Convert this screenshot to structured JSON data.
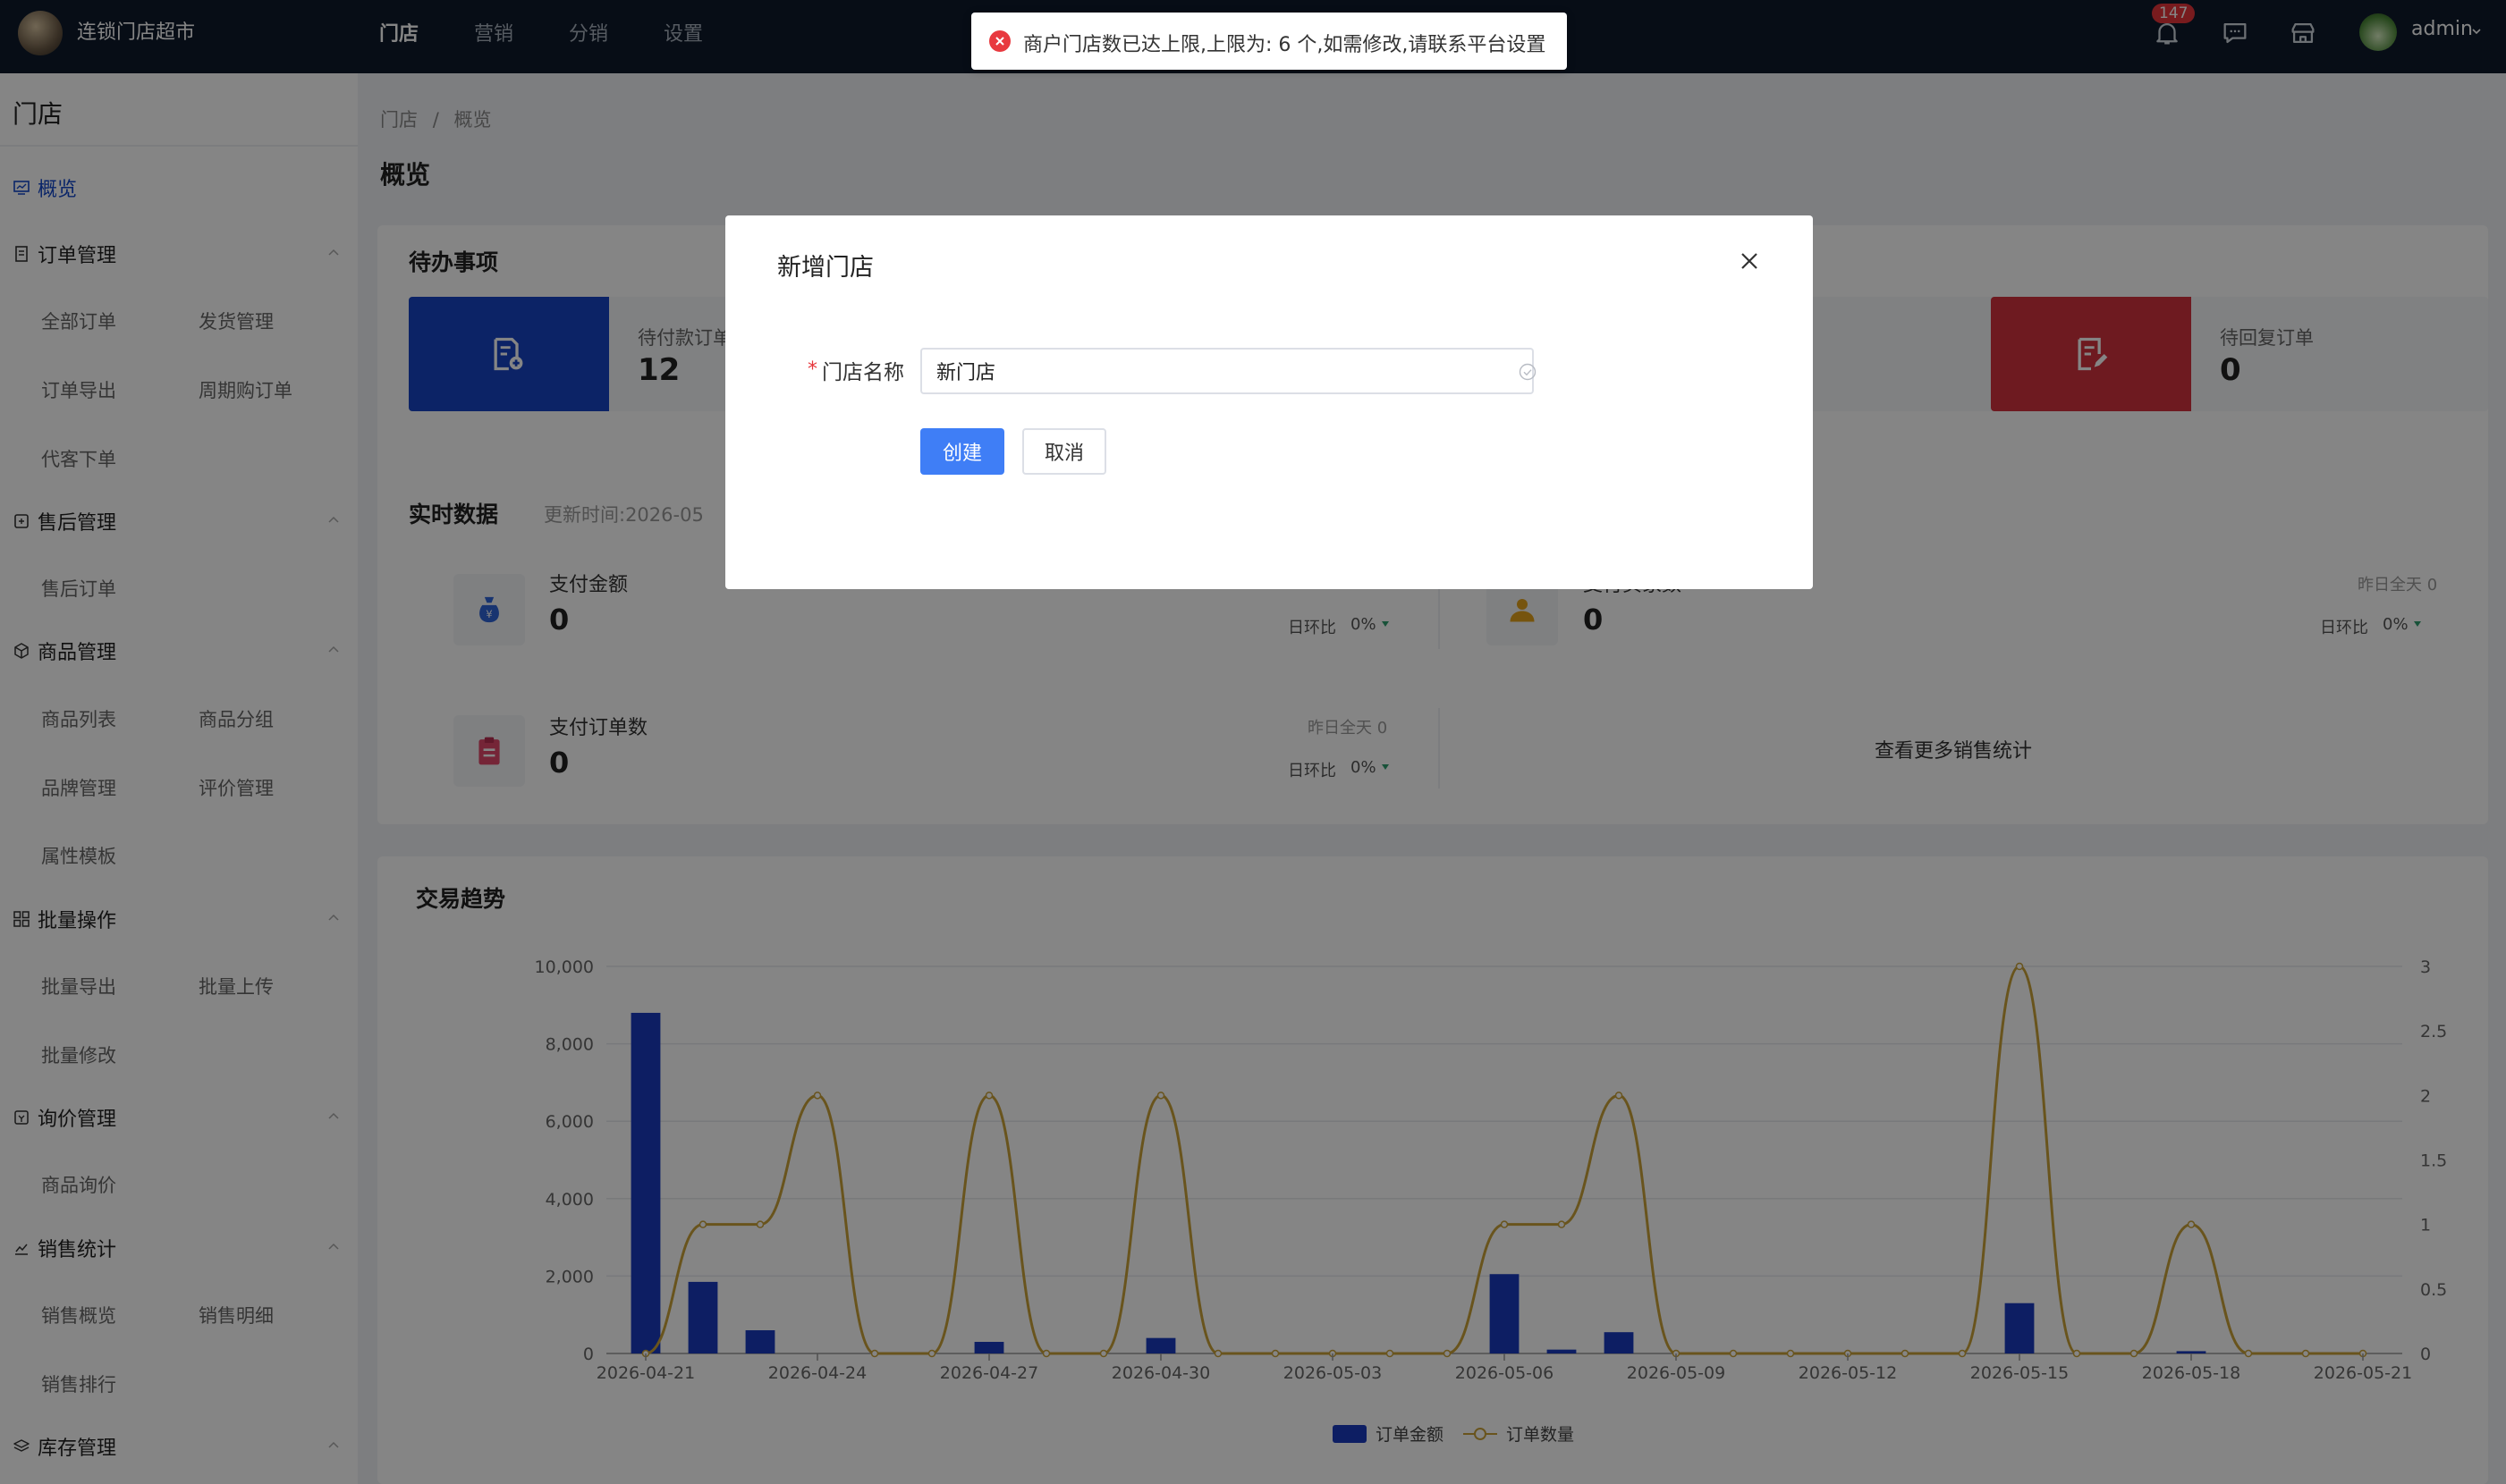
{
  "app": {
    "brand": "连锁门店超市",
    "user": "admin",
    "notification_count": "147"
  },
  "topnav": [
    "门店",
    "营销",
    "分销",
    "设置"
  ],
  "toast": {
    "text": "商户门店数已达上限,上限为: 6 个,如需修改,请联系平台设置"
  },
  "modal": {
    "title": "新增门店",
    "field_label": "门店名称",
    "required_mark": "*",
    "field_value": "新门店",
    "create_label": "创建",
    "cancel_label": "取消"
  },
  "sidebar": {
    "title": "门店",
    "overview": "概览",
    "groups": [
      {
        "label": "订单管理",
        "items": [
          "全部订单",
          "发货管理",
          "订单导出",
          "周期购订单",
          "代客下单"
        ]
      },
      {
        "label": "售后管理",
        "items": [
          "售后订单"
        ]
      },
      {
        "label": "商品管理",
        "items": [
          "商品列表",
          "商品分组",
          "品牌管理",
          "评价管理",
          "属性模板"
        ]
      },
      {
        "label": "批量操作",
        "items": [
          "批量导出",
          "批量上传",
          "批量修改"
        ]
      },
      {
        "label": "询价管理",
        "items": [
          "商品询价"
        ]
      },
      {
        "label": "销售统计",
        "items": [
          "销售概览",
          "销售明细",
          "销售排行"
        ]
      },
      {
        "label": "库存管理",
        "items": []
      }
    ]
  },
  "main": {
    "breadcrumb": [
      "门店",
      "概览"
    ],
    "breadcrumb_sep": "/",
    "page_title": "概览",
    "todo": {
      "title": "待办事项",
      "items": [
        {
          "label": "待付款订单",
          "value": "12",
          "color": "#1743c4"
        },
        {
          "label": "待回复订单",
          "value": "0",
          "color": "#d4323f"
        }
      ]
    },
    "realtime": {
      "title": "实时数据",
      "update_prefix": "更新时间:2026-05",
      "items": [
        {
          "label": "支付金额",
          "value": "0",
          "compare_label": "日环比",
          "compare_value": "0%"
        },
        {
          "label": "支付买家数",
          "value": "0",
          "yesterday": "昨日全天 0",
          "compare_label": "日环比",
          "compare_value": "0%"
        },
        {
          "label": "支付订单数",
          "value": "0",
          "yesterday": "昨日全天 0",
          "compare_label": "日环比",
          "compare_value": "0%"
        }
      ],
      "more": "查看更多销售统计"
    }
  },
  "chart_data": {
    "type": "bar",
    "title": "交易趋势",
    "x": [
      "2026-04-21",
      "2026-04-22",
      "2026-04-23",
      "2026-04-24",
      "2026-04-25",
      "2026-04-26",
      "2026-04-27",
      "2026-04-28",
      "2026-04-29",
      "2026-04-30",
      "2026-05-01",
      "2026-05-02",
      "2026-05-03",
      "2026-05-04",
      "2026-05-05",
      "2026-05-06",
      "2026-05-07",
      "2026-05-08",
      "2026-05-09",
      "2026-05-10",
      "2026-05-11",
      "2026-05-12",
      "2026-05-13",
      "2026-05-14",
      "2026-05-15",
      "2026-05-16",
      "2026-05-17",
      "2026-05-18",
      "2026-05-19",
      "2026-05-20",
      "2026-05-21"
    ],
    "x_tick_labels": [
      "2026-04-21",
      "2026-04-24",
      "2026-04-27",
      "2026-04-30",
      "2026-05-03",
      "2026-05-06",
      "2026-05-09",
      "2026-05-12",
      "2026-05-15",
      "2026-05-18",
      "2026-05-21"
    ],
    "series": [
      {
        "name": "订单金额",
        "type": "bar",
        "axis": "left",
        "color": "#1a3bbf",
        "values": [
          8800,
          1850,
          600,
          0,
          0,
          0,
          300,
          0,
          0,
          400,
          0,
          0,
          0,
          0,
          0,
          2050,
          100,
          550,
          0,
          0,
          0,
          0,
          0,
          0,
          1300,
          0,
          0,
          60,
          0,
          0,
          0
        ]
      },
      {
        "name": "订单数量",
        "type": "line",
        "smooth": true,
        "axis": "right",
        "color": "#c9a238",
        "values": [
          0,
          1,
          1,
          2,
          0,
          0,
          2,
          0,
          0,
          2,
          0,
          0,
          0,
          0,
          0,
          1,
          1,
          2,
          0,
          0,
          0,
          0,
          0,
          0,
          3,
          0,
          0,
          1,
          0,
          0,
          0
        ]
      }
    ],
    "y_left": {
      "min": 0,
      "max": 10000,
      "ticks": [
        "0",
        "2,000",
        "4,000",
        "6,000",
        "8,000",
        "10,000"
      ]
    },
    "y_right": {
      "min": 0,
      "max": 3,
      "ticks": [
        "0",
        "0.5",
        "1",
        "1.5",
        "2",
        "2.5",
        "3"
      ]
    },
    "legend_position": "bottom-center",
    "grid": true
  }
}
